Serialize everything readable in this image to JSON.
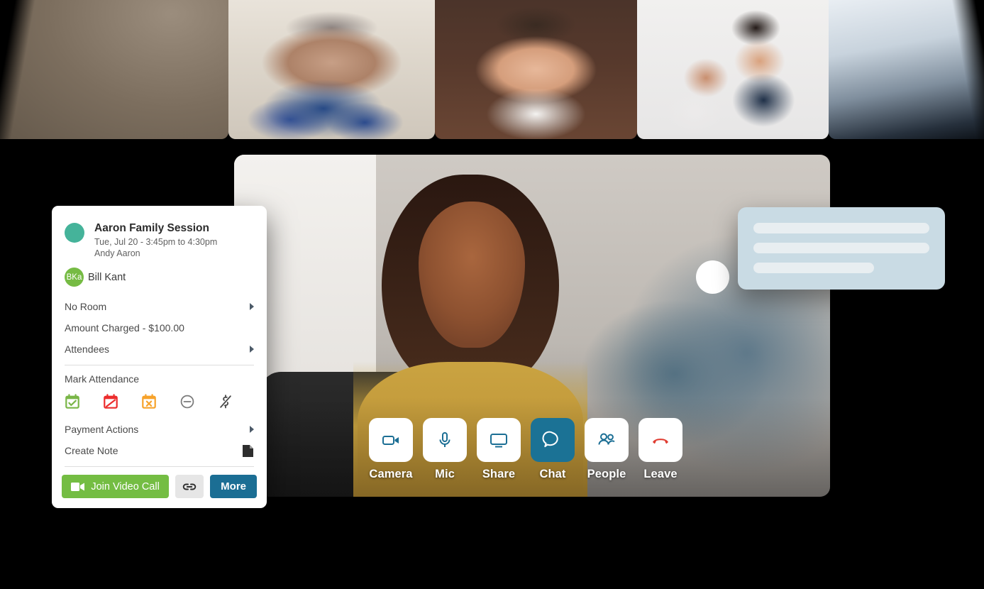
{
  "filmstrip": {
    "tiles": [
      {
        "name": "participant-tile-left-edge",
        "label": ""
      },
      {
        "name": "participant-tile-1",
        "label": ""
      },
      {
        "name": "participant-tile-2",
        "label": ""
      },
      {
        "name": "participant-tile-3",
        "label": ""
      },
      {
        "name": "participant-tile-right-edge",
        "label": ""
      }
    ]
  },
  "session_card": {
    "title": "Aaron Family Session",
    "time": "Tue, Jul 20 - 3:45pm to 4:30pm",
    "organizer": "Andy Aaron",
    "attendee": {
      "initials": "BKa",
      "name": "Bill Kant",
      "avatar_color": "#76bb44"
    },
    "avatar_color": "#45b39a",
    "rows": [
      {
        "label": "No Room",
        "chevron": true
      },
      {
        "label": "Amount Charged - $100.00",
        "chevron": false
      },
      {
        "label": "Attendees",
        "chevron": true
      }
    ],
    "mark_attendance_label": "Mark Attendance",
    "attendance_icons": [
      {
        "name": "attendance-present-icon",
        "color": "#7ab648"
      },
      {
        "name": "attendance-absent-icon",
        "color": "#ec2d2d"
      },
      {
        "name": "attendance-cancelled-icon",
        "color": "#f7a32b"
      },
      {
        "name": "attendance-none-icon",
        "color": "#7a7a7a"
      },
      {
        "name": "attendance-no-charge-icon",
        "color": "#4a4a4a"
      }
    ],
    "secondary_rows": [
      {
        "label": "Payment Actions",
        "chevron": true
      },
      {
        "label": "Create Note",
        "chevron": false
      }
    ],
    "actions": {
      "join_label": "Join Video Call",
      "more_label": "More",
      "join_color": "#74bd43",
      "more_color": "#1b6e94",
      "copy_link_color": "#e6e6e6"
    }
  },
  "call_controls": {
    "active_color": "#1b7295",
    "icon_color": "#1b6e94",
    "buttons": [
      {
        "label": "Camera",
        "icon": "camera-icon",
        "active": false
      },
      {
        "label": "Mic",
        "icon": "microphone-icon",
        "active": false
      },
      {
        "label": "Share",
        "icon": "screen-share-icon",
        "active": false
      },
      {
        "label": "Chat",
        "icon": "chat-bubble-icon",
        "active": true
      },
      {
        "label": "People",
        "icon": "people-icon",
        "active": false
      },
      {
        "label": "Leave",
        "icon": "hang-up-icon",
        "active": false
      }
    ]
  },
  "chat_overlay": {
    "bubble_color": "#c9dbe4",
    "line_color": "#e8eef1",
    "avatar_color": "#ffffff",
    "lines": [
      "",
      "",
      ""
    ]
  }
}
